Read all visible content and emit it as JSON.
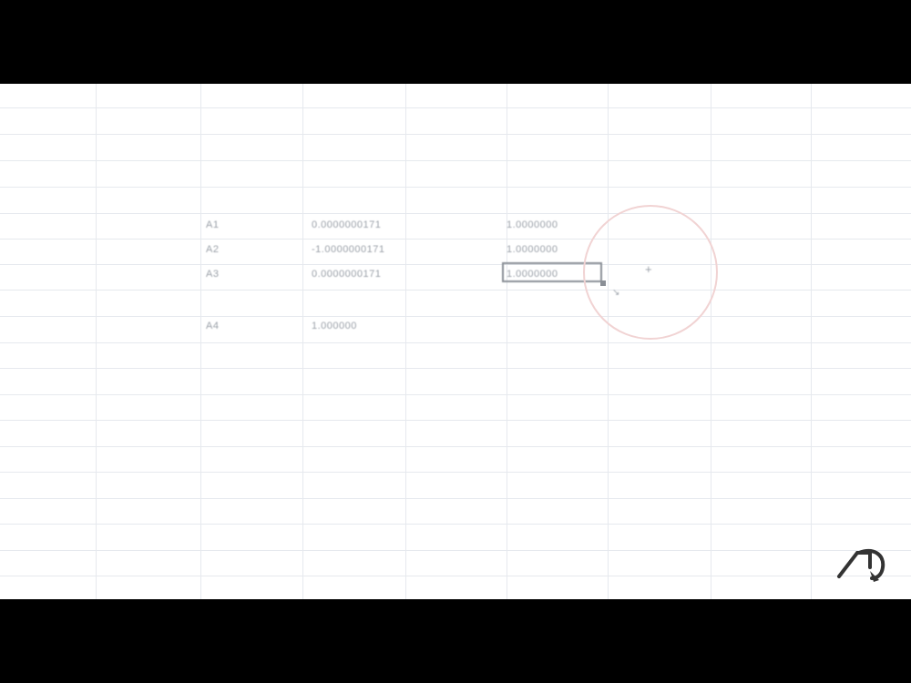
{
  "spreadsheet": {
    "rows": [
      {
        "row_label": "A1",
        "value_b": "0.0000000171",
        "value_c": "1.0000000"
      },
      {
        "row_label": "A2",
        "value_b": "-1.0000000171",
        "value_c": "1.0000000"
      },
      {
        "row_label": "A3",
        "value_b": "0.0000000171",
        "value_c": "1.0000000"
      },
      {
        "row_label": "A4",
        "value_b": "1.000000",
        "value_c": ""
      }
    ],
    "cursor_glyph": "+",
    "cursor_mark": "↘"
  },
  "colors": {
    "grid": "#e6e9ee",
    "selection_border": "#8a8f96",
    "cursor_ring": "#f1d3d3",
    "letterbox": "#000000"
  },
  "icons": {
    "watermark": "logo-icon"
  }
}
